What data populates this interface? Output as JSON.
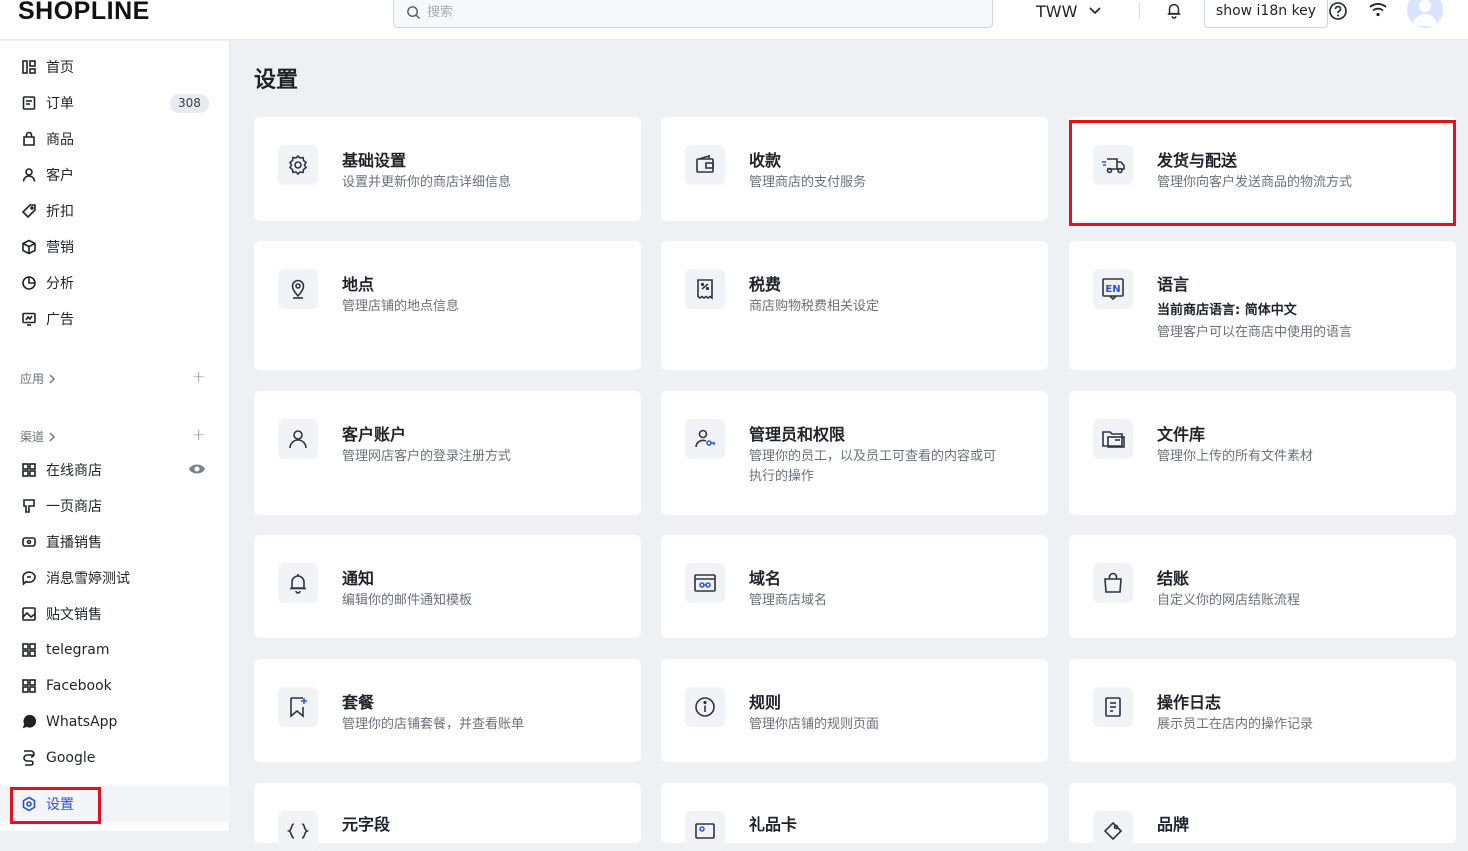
{
  "brand": {
    "logo": "SHOPLINE"
  },
  "header": {
    "search_placeholder": "搜索",
    "store_name": "TWW",
    "i18n_button": "show i18n key"
  },
  "sidebar": {
    "items": [
      {
        "label": "首页",
        "icon": "dashboard-icon"
      },
      {
        "label": "订单",
        "icon": "order-icon",
        "badge": "308"
      },
      {
        "label": "商品",
        "icon": "bag-icon"
      },
      {
        "label": "客户",
        "icon": "user-icon"
      },
      {
        "label": "折扣",
        "icon": "tag-icon"
      },
      {
        "label": "营销",
        "icon": "cube-icon"
      },
      {
        "label": "分析",
        "icon": "chart-icon"
      },
      {
        "label": "广告",
        "icon": "ad-icon"
      }
    ],
    "apps_label": "应用",
    "channels_label": "渠道",
    "channels": [
      {
        "label": "在线商店",
        "icon": "grid-icon"
      },
      {
        "label": "一页商店",
        "icon": "page-icon"
      },
      {
        "label": "直播销售",
        "icon": "live-icon"
      },
      {
        "label": "消息雪婷测试",
        "icon": "message-icon"
      },
      {
        "label": "贴文销售",
        "icon": "post-icon"
      },
      {
        "label": "telegram",
        "icon": "grid-icon"
      },
      {
        "label": "Facebook",
        "icon": "grid-icon"
      },
      {
        "label": "WhatsApp",
        "icon": "whatsapp-icon"
      },
      {
        "label": "Google",
        "icon": "google-icon"
      }
    ],
    "settings_label": "设置"
  },
  "main": {
    "title": "设置",
    "cards": [
      {
        "title": "基础设置",
        "desc": "设置并更新你的商店详细信息",
        "icon": "gear-icon"
      },
      {
        "title": "收款",
        "desc": "管理商店的支付服务",
        "icon": "wallet-icon"
      },
      {
        "title": "发货与配送",
        "desc": "管理你向客户发送商品的物流方式",
        "icon": "truck-icon"
      },
      {
        "title": "地点",
        "desc": "管理店铺的地点信息",
        "icon": "location-icon"
      },
      {
        "title": "税费",
        "desc": "商店购物税费相关设定",
        "icon": "receipt-icon"
      },
      {
        "title": "语言",
        "sub": "当前商店语言: 简体中文",
        "desc": "管理客户可以在商店中使用的语言",
        "icon": "language-icon",
        "icon_text": "EN"
      },
      {
        "title": "客户账户",
        "desc": "管理网店客户的登录注册方式",
        "icon": "account-icon"
      },
      {
        "title": "管理员和权限",
        "desc": "管理你的员工，以及员工可查看的内容或可",
        "desc2": "执行的操作",
        "icon": "admin-key-icon"
      },
      {
        "title": "文件库",
        "desc": "管理你上传的所有文件素材",
        "icon": "folder-icon"
      },
      {
        "title": "通知",
        "desc": "编辑你的邮件通知模板",
        "icon": "bell-icon"
      },
      {
        "title": "域名",
        "desc": "管理商店域名",
        "icon": "domain-icon"
      },
      {
        "title": "结账",
        "desc": "自定义你的网店结账流程",
        "icon": "checkout-bag-icon"
      },
      {
        "title": "套餐",
        "desc": "管理你的店铺套餐，并查看账单",
        "icon": "plan-icon"
      },
      {
        "title": "规则",
        "desc": "管理你店铺的规则页面",
        "icon": "info-icon"
      },
      {
        "title": "操作日志",
        "desc": "展示员工在店内的操作记录",
        "icon": "log-icon"
      },
      {
        "title": "元字段",
        "icon": "metafield-icon"
      },
      {
        "title": "礼品卡",
        "icon": "giftcard-icon"
      },
      {
        "title": "品牌",
        "icon": "brand-icon"
      }
    ]
  }
}
